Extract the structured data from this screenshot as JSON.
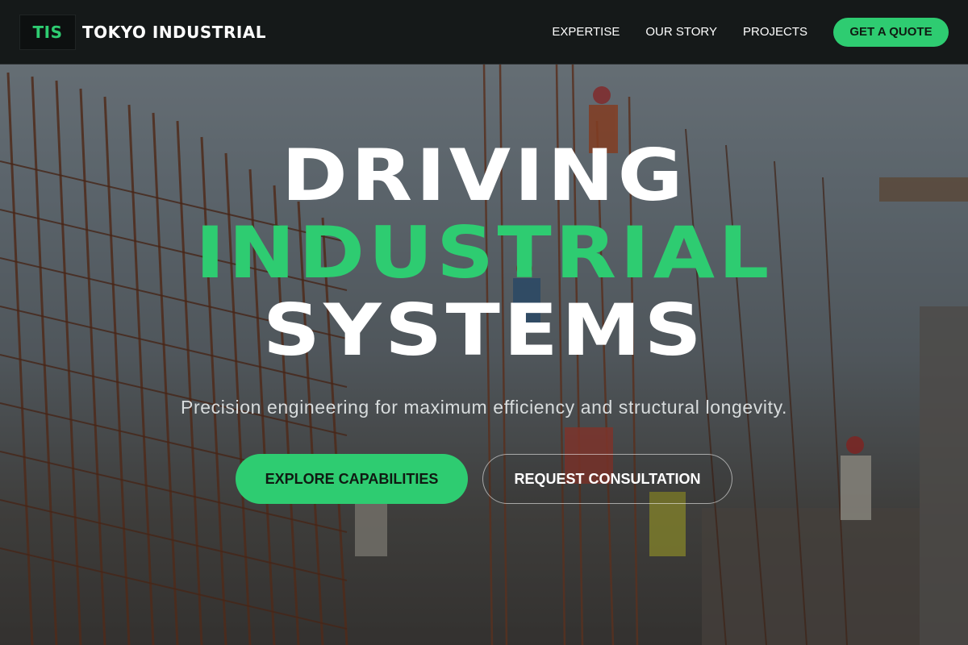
{
  "brand": {
    "logo_text": "TIS",
    "name": "TOKYO INDUSTRIAL"
  },
  "nav": {
    "items": [
      {
        "label": "EXPERTISE"
      },
      {
        "label": "OUR STORY"
      },
      {
        "label": "PROJECTS"
      }
    ],
    "cta_label": "GET A QUOTE"
  },
  "hero": {
    "headline": {
      "line1": "DRIVING",
      "line2": "INDUSTRIAL",
      "line3": "SYSTEMS"
    },
    "subtitle": "Precision engineering for maximum efficiency and structural longevity.",
    "primary_button": "EXPLORE CAPABILITIES",
    "secondary_button": "REQUEST CONSULTATION",
    "background_image": "construction-site-photo"
  },
  "colors": {
    "accent": "#2ecc71",
    "navbar_bg": "#151919",
    "text": "#ffffff"
  }
}
